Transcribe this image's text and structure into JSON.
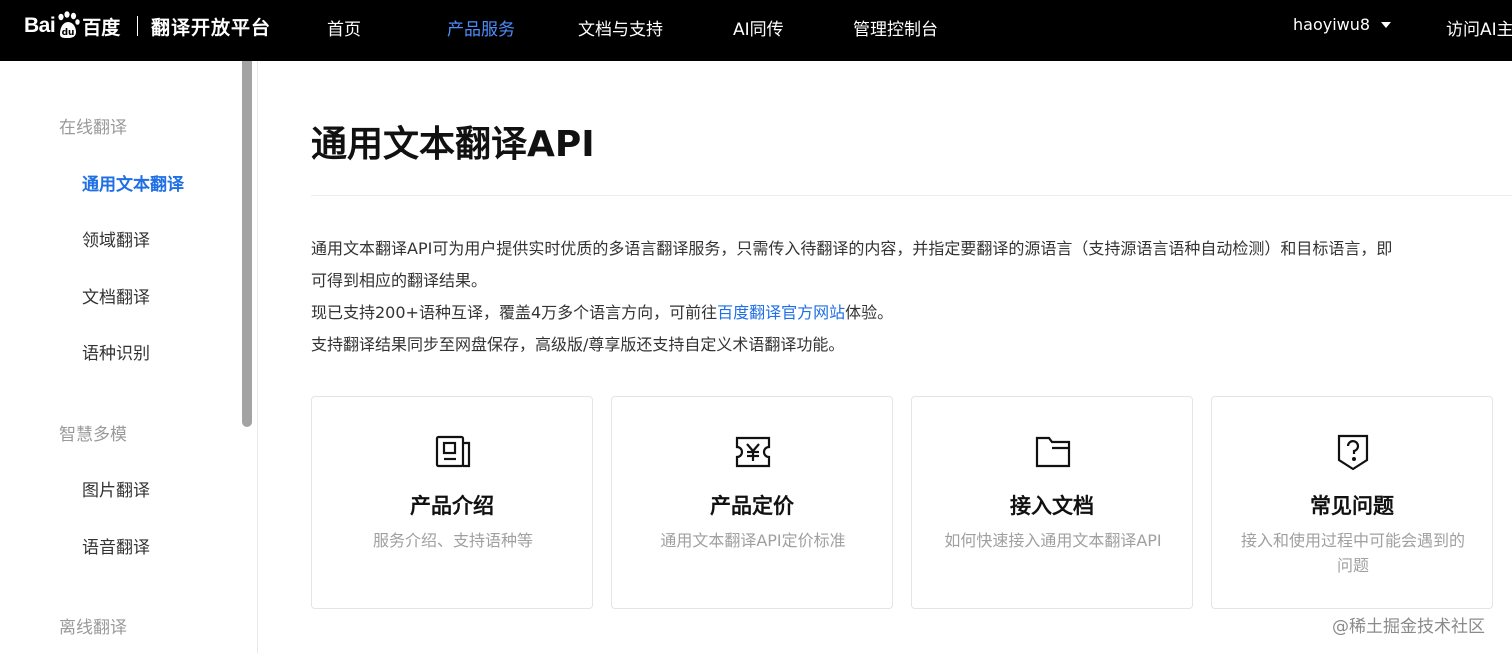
{
  "header": {
    "logo_bai": "Bai",
    "logo_cn": "百度",
    "platform": "翻译开放平台",
    "nav": [
      {
        "label": "首页"
      },
      {
        "label": "产品服务"
      },
      {
        "label": "文档与支持"
      },
      {
        "label": "AI同传"
      },
      {
        "label": "管理控制台"
      }
    ],
    "username": "haoyiwu8",
    "visit_label": "访问AI主"
  },
  "sidebar": {
    "groups": [
      {
        "title": "在线翻译",
        "items": [
          "通用文本翻译",
          "领域翻译",
          "文档翻译",
          "语种识别"
        ]
      },
      {
        "title": "智慧多模",
        "items": [
          "图片翻译",
          "语音翻译"
        ]
      },
      {
        "title": "离线翻译",
        "items": []
      }
    ],
    "active_item": "通用文本翻译"
  },
  "main": {
    "title": "通用文本翻译API",
    "intro_line1": "通用文本翻译API可为用户提供实时优质的多语言翻译服务，只需传入待翻译的内容，并指定要翻译的源语言（支持源语言语种自动检测）和目标语言，即",
    "intro_line2": "可得到相应的翻译结果。",
    "intro_line3_prefix": "现已支持200+语种互译，覆盖4万多个语言方向，可前往",
    "intro_line3_link": "百度翻译官方网站",
    "intro_line3_suffix": "体验。",
    "intro_line4": "支持翻译结果同步至网盘保存，高级版/尊享版还支持自定义术语翻译功能。",
    "cards": [
      {
        "icon": "product-intro-icon",
        "title": "产品介绍",
        "desc": "服务介绍、支持语种等"
      },
      {
        "icon": "pricing-icon",
        "title": "产品定价",
        "desc": "通用文本翻译API定价标准"
      },
      {
        "icon": "folder-icon",
        "title": "接入文档",
        "desc": "如何快速接入通用文本翻译API"
      },
      {
        "icon": "question-shield-icon",
        "title": "常见问题",
        "desc": "接入和使用过程中可能会遇到的问题"
      }
    ]
  },
  "watermark": "@稀土掘金技术社区",
  "colors": {
    "topbar": "#000000",
    "accent": "#1f6fe5",
    "nav_active": "#4c8dfc"
  }
}
